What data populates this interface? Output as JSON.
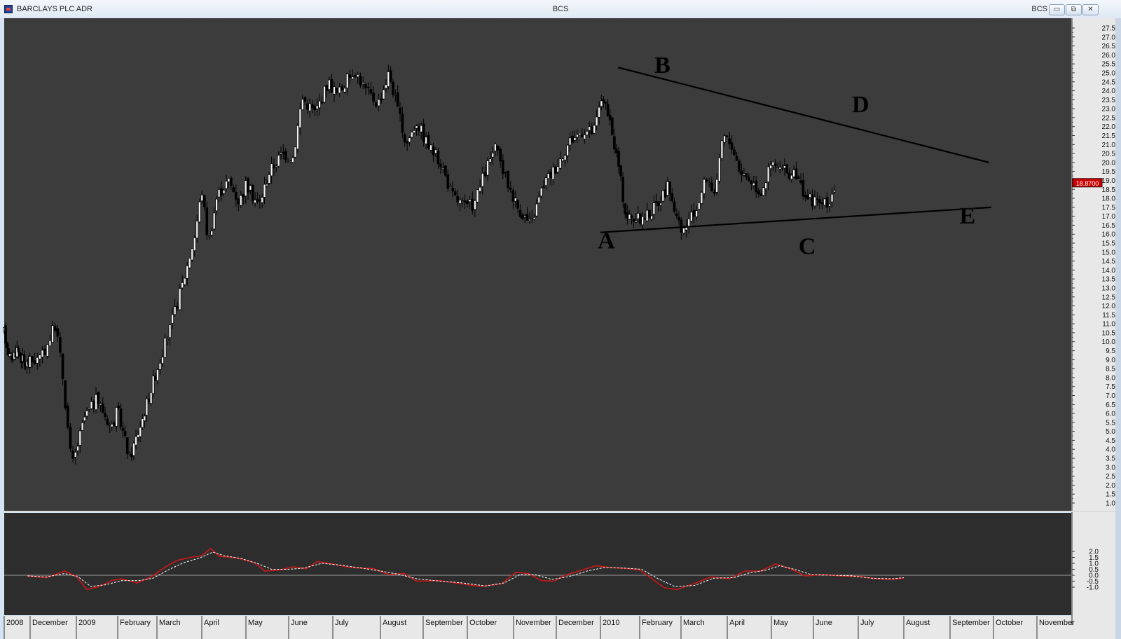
{
  "window": {
    "title": "BARCLAYS PLC ADR",
    "center_title": "BCS",
    "right_title": "BCS",
    "buttons": {
      "minimize": "▭",
      "restore": "⧉",
      "close": "✕"
    }
  },
  "colors": {
    "panel_bg": "#3c3c3c",
    "osc_bg": "#2d2d2d",
    "axis_bg": "#e8e8e8",
    "candle": "#000000",
    "osc_line": "#cc1818",
    "signal_line": "#ffffff",
    "price_tag": "#cc0000"
  },
  "chart_data": [
    {
      "type": "candlestick",
      "price_tag": "18.8700",
      "yticks": [
        "1.0",
        "1.5",
        "2.0",
        "2.5",
        "3.0",
        "3.5",
        "4.0",
        "4.5",
        "5.0",
        "5.5",
        "6.0",
        "6.5",
        "7.0",
        "7.5",
        "8.0",
        "8.5",
        "9.0",
        "9.5",
        "10.0",
        "10.5",
        "11.0",
        "11.5",
        "12.0",
        "12.5",
        "13.0",
        "13.5",
        "14.0",
        "14.5",
        "15.0",
        "15.5",
        "16.0",
        "16.5",
        "17.0",
        "17.5",
        "18.0",
        "18.5",
        "19.0",
        "19.5",
        "20.0",
        "20.5",
        "21.0",
        "21.5",
        "22.0",
        "22.5",
        "23.0",
        "23.5",
        "24.0",
        "24.5",
        "25.0",
        "25.5",
        "26.0",
        "26.5",
        "27.0",
        "27.5"
      ],
      "ylim": [
        1.0,
        27.5
      ],
      "x_months": [
        "2008",
        "December",
        "2009",
        "February",
        "March",
        "April",
        "May",
        "June",
        "July",
        "August",
        "September",
        "October",
        "November",
        "December",
        "2010",
        "February",
        "March",
        "April",
        "May",
        "June",
        "July",
        "August",
        "September",
        "October",
        "November"
      ],
      "anchors": [
        {
          "m": 0.0,
          "p": 10.5
        },
        {
          "m": 0.25,
          "p": 9.0
        },
        {
          "m": 0.5,
          "p": 9.6
        },
        {
          "m": 0.8,
          "p": 8.7
        },
        {
          "m": 1.25,
          "p": 9.1
        },
        {
          "m": 1.55,
          "p": 11.0
        },
        {
          "m": 1.7,
          "p": 8.2
        },
        {
          "m": 1.9,
          "p": 3.0
        },
        {
          "m": 2.2,
          "p": 5.8
        },
        {
          "m": 2.5,
          "p": 6.8
        },
        {
          "m": 2.85,
          "p": 5.2
        },
        {
          "m": 3.0,
          "p": 6.2
        },
        {
          "m": 3.3,
          "p": 3.5
        },
        {
          "m": 3.6,
          "p": 5.5
        },
        {
          "m": 4.0,
          "p": 8.5
        },
        {
          "m": 4.3,
          "p": 10.8
        },
        {
          "m": 4.6,
          "p": 13.5
        },
        {
          "m": 4.85,
          "p": 16.0
        },
        {
          "m": 5.0,
          "p": 18.5
        },
        {
          "m": 5.15,
          "p": 15.5
        },
        {
          "m": 5.35,
          "p": 18.2
        },
        {
          "m": 5.6,
          "p": 19.0
        },
        {
          "m": 5.85,
          "p": 17.8
        },
        {
          "m": 6.0,
          "p": 18.8
        },
        {
          "m": 6.3,
          "p": 17.6
        },
        {
          "m": 6.55,
          "p": 19.5
        },
        {
          "m": 6.85,
          "p": 20.5
        },
        {
          "m": 7.1,
          "p": 20.3
        },
        {
          "m": 7.3,
          "p": 23.6
        },
        {
          "m": 7.6,
          "p": 22.8
        },
        {
          "m": 7.9,
          "p": 24.5
        },
        {
          "m": 8.1,
          "p": 23.8
        },
        {
          "m": 8.45,
          "p": 25.2
        },
        {
          "m": 8.7,
          "p": 24.0
        },
        {
          "m": 8.95,
          "p": 23.3
        },
        {
          "m": 9.2,
          "p": 25.0
        },
        {
          "m": 9.45,
          "p": 22.5
        },
        {
          "m": 9.6,
          "p": 21.0
        },
        {
          "m": 9.85,
          "p": 22.3
        },
        {
          "m": 10.1,
          "p": 21.0
        },
        {
          "m": 10.4,
          "p": 20.0
        },
        {
          "m": 10.65,
          "p": 18.2
        },
        {
          "m": 10.95,
          "p": 17.5
        },
        {
          "m": 11.15,
          "p": 17.7
        },
        {
          "m": 11.4,
          "p": 19.6
        },
        {
          "m": 11.6,
          "p": 20.8
        },
        {
          "m": 11.85,
          "p": 19.0
        },
        {
          "m": 12.1,
          "p": 17.5
        },
        {
          "m": 12.4,
          "p": 16.5
        },
        {
          "m": 12.7,
          "p": 18.8
        },
        {
          "m": 13.0,
          "p": 19.8
        },
        {
          "m": 13.3,
          "p": 21.2
        },
        {
          "m": 13.6,
          "p": 21.8
        },
        {
          "m": 13.85,
          "p": 21.7
        },
        {
          "m": 14.05,
          "p": 23.8
        },
        {
          "m": 14.25,
          "p": 22.0
        },
        {
          "m": 14.45,
          "p": 20.0
        },
        {
          "m": 14.65,
          "p": 17.0
        },
        {
          "m": 15.0,
          "p": 16.8
        },
        {
          "m": 15.3,
          "p": 17.3
        },
        {
          "m": 15.7,
          "p": 18.7
        },
        {
          "m": 16.0,
          "p": 16.0
        },
        {
          "m": 16.3,
          "p": 17.2
        },
        {
          "m": 16.55,
          "p": 19.2
        },
        {
          "m": 16.75,
          "p": 18.2
        },
        {
          "m": 16.9,
          "p": 21.5
        },
        {
          "m": 17.1,
          "p": 21.0
        },
        {
          "m": 17.3,
          "p": 19.5
        },
        {
          "m": 17.55,
          "p": 19.0
        },
        {
          "m": 17.75,
          "p": 18.3
        },
        {
          "m": 18.0,
          "p": 19.9
        },
        {
          "m": 18.3,
          "p": 19.5
        },
        {
          "m": 18.6,
          "p": 19.2
        },
        {
          "m": 18.85,
          "p": 18.0
        },
        {
          "m": 19.1,
          "p": 17.8
        },
        {
          "m": 19.3,
          "p": 17.6
        },
        {
          "m": 19.5,
          "p": 18.8
        }
      ],
      "annotations": [
        {
          "label": "A",
          "m": 14.15,
          "p": 15.2
        },
        {
          "label": "B",
          "m": 15.55,
          "p": 25.0
        },
        {
          "label": "C",
          "m": 18.85,
          "p": 14.9
        },
        {
          "label": "D",
          "m": 20.05,
          "p": 22.8
        },
        {
          "label": "E",
          "m": 22.4,
          "p": 16.6
        }
      ],
      "trendlines": [
        {
          "from": {
            "m": 14.0,
            "p": 16.1
          },
          "to": {
            "m": 22.95,
            "p": 17.5
          }
        },
        {
          "from": {
            "m": 14.45,
            "p": 25.3
          },
          "to": {
            "m": 22.9,
            "p": 20.0
          }
        }
      ]
    },
    {
      "type": "line",
      "yticks": [
        "-1.0",
        "-0.5",
        "0.0",
        "0.5",
        "1.0",
        "1.5",
        "2.0"
      ],
      "ylim": [
        -1.3,
        2.3
      ],
      "series": [
        {
          "key": "oscillator",
          "points": [
            {
              "m": 0.9,
              "v": -0.05
            },
            {
              "m": 1.35,
              "v": -0.2
            },
            {
              "m": 1.75,
              "v": 0.35
            },
            {
              "m": 2.0,
              "v": -0.1
            },
            {
              "m": 2.25,
              "v": -1.2
            },
            {
              "m": 2.55,
              "v": -0.95
            },
            {
              "m": 2.85,
              "v": -0.45
            },
            {
              "m": 3.1,
              "v": -0.3
            },
            {
              "m": 3.5,
              "v": -0.65
            },
            {
              "m": 3.85,
              "v": -0.15
            },
            {
              "m": 4.15,
              "v": 0.6
            },
            {
              "m": 4.45,
              "v": 1.25
            },
            {
              "m": 4.75,
              "v": 1.5
            },
            {
              "m": 5.0,
              "v": 1.65
            },
            {
              "m": 5.2,
              "v": 2.25
            },
            {
              "m": 5.4,
              "v": 1.6
            },
            {
              "m": 5.8,
              "v": 1.45
            },
            {
              "m": 6.2,
              "v": 1.05
            },
            {
              "m": 6.45,
              "v": 0.35
            },
            {
              "m": 6.8,
              "v": 0.45
            },
            {
              "m": 7.1,
              "v": 0.7
            },
            {
              "m": 7.4,
              "v": 0.55
            },
            {
              "m": 7.65,
              "v": 1.15
            },
            {
              "m": 8.0,
              "v": 0.95
            },
            {
              "m": 8.35,
              "v": 0.65
            },
            {
              "m": 8.85,
              "v": 0.55
            },
            {
              "m": 9.2,
              "v": 0.05
            },
            {
              "m": 9.55,
              "v": 0.15
            },
            {
              "m": 9.85,
              "v": -0.5
            },
            {
              "m": 10.35,
              "v": -0.45
            },
            {
              "m": 10.85,
              "v": -0.7
            },
            {
              "m": 11.3,
              "v": -0.95
            },
            {
              "m": 11.75,
              "v": -0.7
            },
            {
              "m": 12.05,
              "v": 0.25
            },
            {
              "m": 12.35,
              "v": 0.15
            },
            {
              "m": 12.65,
              "v": -0.45
            },
            {
              "m": 12.95,
              "v": -0.5
            },
            {
              "m": 13.2,
              "v": 0.0
            },
            {
              "m": 13.55,
              "v": 0.4
            },
            {
              "m": 13.9,
              "v": 0.8
            },
            {
              "m": 14.25,
              "v": 0.65
            },
            {
              "m": 14.7,
              "v": 0.55
            },
            {
              "m": 15.0,
              "v": 0.45
            },
            {
              "m": 15.3,
              "v": -0.3
            },
            {
              "m": 15.6,
              "v": -1.05
            },
            {
              "m": 15.9,
              "v": -1.2
            },
            {
              "m": 16.25,
              "v": -0.75
            },
            {
              "m": 16.65,
              "v": -0.15
            },
            {
              "m": 17.05,
              "v": -0.3
            },
            {
              "m": 17.4,
              "v": 0.35
            },
            {
              "m": 17.75,
              "v": 0.35
            },
            {
              "m": 18.1,
              "v": 0.95
            },
            {
              "m": 18.45,
              "v": 0.55
            },
            {
              "m": 18.8,
              "v": -0.05
            },
            {
              "m": 19.2,
              "v": 0.05
            },
            {
              "m": 19.6,
              "v": -0.05
            },
            {
              "m": 20.0,
              "v": -0.1
            },
            {
              "m": 20.4,
              "v": -0.3
            },
            {
              "m": 20.75,
              "v": -0.35
            },
            {
              "m": 21.0,
              "v": -0.25
            }
          ]
        },
        {
          "key": "signal",
          "points": [
            {
              "m": 0.9,
              "v": -0.05
            },
            {
              "m": 1.35,
              "v": -0.15
            },
            {
              "m": 1.75,
              "v": 0.15
            },
            {
              "m": 2.05,
              "v": -0.15
            },
            {
              "m": 2.35,
              "v": -0.95
            },
            {
              "m": 2.7,
              "v": -0.8
            },
            {
              "m": 3.1,
              "v": -0.45
            },
            {
              "m": 3.55,
              "v": -0.45
            },
            {
              "m": 3.9,
              "v": -0.25
            },
            {
              "m": 4.25,
              "v": 0.45
            },
            {
              "m": 4.6,
              "v": 1.05
            },
            {
              "m": 4.95,
              "v": 1.45
            },
            {
              "m": 5.25,
              "v": 1.95
            },
            {
              "m": 5.5,
              "v": 1.65
            },
            {
              "m": 5.9,
              "v": 1.4
            },
            {
              "m": 6.3,
              "v": 0.95
            },
            {
              "m": 6.6,
              "v": 0.5
            },
            {
              "m": 7.0,
              "v": 0.5
            },
            {
              "m": 7.35,
              "v": 0.6
            },
            {
              "m": 7.75,
              "v": 1.0
            },
            {
              "m": 8.15,
              "v": 0.85
            },
            {
              "m": 8.6,
              "v": 0.6
            },
            {
              "m": 9.0,
              "v": 0.35
            },
            {
              "m": 9.4,
              "v": 0.1
            },
            {
              "m": 9.85,
              "v": -0.3
            },
            {
              "m": 10.4,
              "v": -0.5
            },
            {
              "m": 10.9,
              "v": -0.65
            },
            {
              "m": 11.4,
              "v": -0.9
            },
            {
              "m": 11.8,
              "v": -0.65
            },
            {
              "m": 12.15,
              "v": 0.05
            },
            {
              "m": 12.5,
              "v": 0.05
            },
            {
              "m": 12.9,
              "v": -0.35
            },
            {
              "m": 13.3,
              "v": -0.1
            },
            {
              "m": 13.7,
              "v": 0.35
            },
            {
              "m": 14.1,
              "v": 0.65
            },
            {
              "m": 14.6,
              "v": 0.6
            },
            {
              "m": 15.05,
              "v": 0.5
            },
            {
              "m": 15.45,
              "v": -0.3
            },
            {
              "m": 15.85,
              "v": -0.95
            },
            {
              "m": 16.3,
              "v": -0.85
            },
            {
              "m": 16.7,
              "v": -0.25
            },
            {
              "m": 17.15,
              "v": -0.2
            },
            {
              "m": 17.5,
              "v": 0.2
            },
            {
              "m": 17.85,
              "v": 0.4
            },
            {
              "m": 18.2,
              "v": 0.8
            },
            {
              "m": 18.6,
              "v": 0.45
            },
            {
              "m": 18.95,
              "v": 0.05
            },
            {
              "m": 19.4,
              "v": 0.0
            },
            {
              "m": 19.85,
              "v": -0.05
            },
            {
              "m": 20.3,
              "v": -0.25
            },
            {
              "m": 20.75,
              "v": -0.3
            },
            {
              "m": 21.0,
              "v": -0.2
            }
          ]
        }
      ]
    }
  ]
}
